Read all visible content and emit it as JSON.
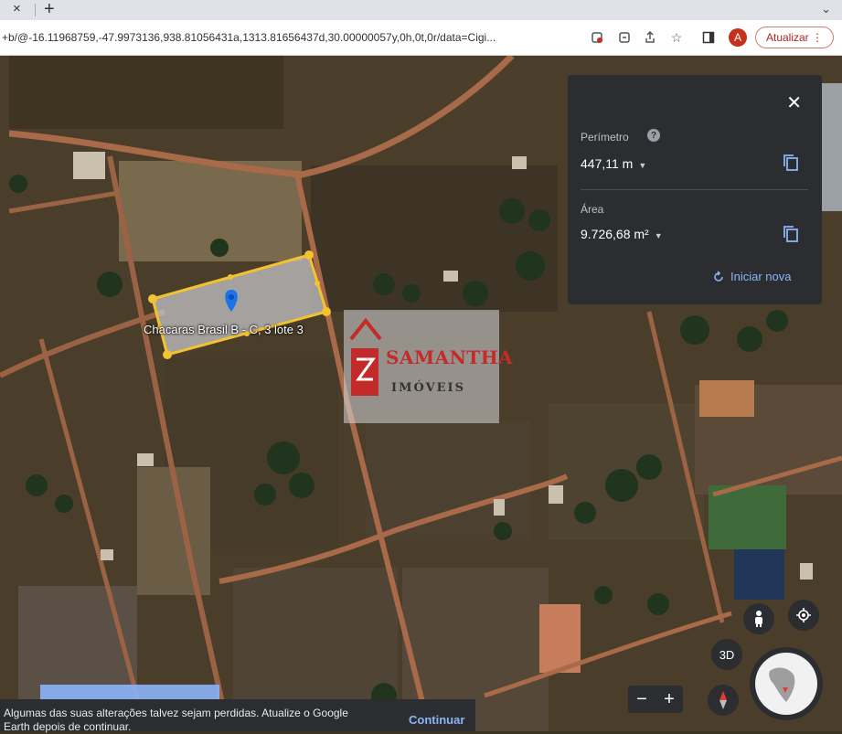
{
  "browser": {
    "url": "+b/@-16.11968759,-47.9973136,938.81056431a,1313.81656437d,30.00000057y,0h,0t,0r/data=Cigi...",
    "tab_close_glyph": "×",
    "new_tab_glyph": "+",
    "avatar_letter": "A",
    "update_label": "Atualizar"
  },
  "map": {
    "place_label": "Chacaras Brasil B - C, 3 lote 3"
  },
  "measure_panel": {
    "perimeter_label": "Perímetro",
    "perimeter_value": "447,11 m",
    "area_label": "Área",
    "area_value": "9.726,68 m²",
    "restart_label": "Iniciar nova"
  },
  "watermark": {
    "brand": "SAMANTHA",
    "subtitle": "IMÓVEIS"
  },
  "controls": {
    "view_3d_label": "3D",
    "zoom_out": "−",
    "zoom_in": "+"
  },
  "notification": {
    "text": "Algumas das suas alterações talvez sejam perdidas. Atualize o Google Earth depois de continuar.",
    "action": "Continuar"
  },
  "colors": {
    "polygon_outline": "#f2c230",
    "panel_bg": "#2b2d30",
    "link_blue": "#8ab4f8",
    "watermark_red": "#c32b2b"
  }
}
